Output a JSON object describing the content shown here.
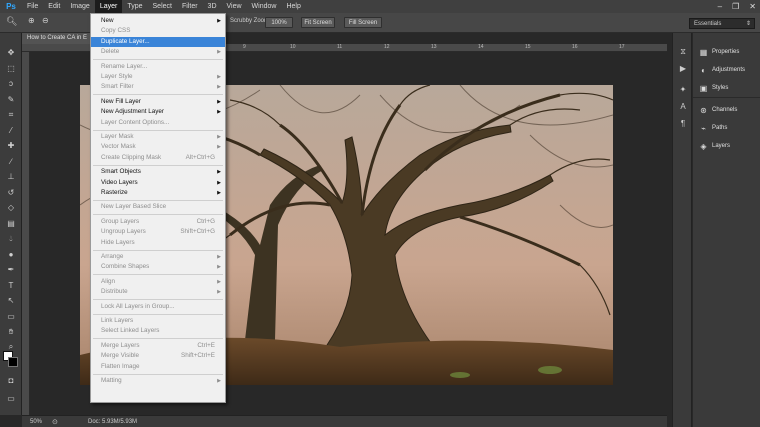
{
  "menubar": {
    "logo": "Ps",
    "items": [
      "File",
      "Edit",
      "Image",
      "Layer",
      "Type",
      "Select",
      "Filter",
      "3D",
      "View",
      "Window",
      "Help"
    ],
    "active_index": 3
  },
  "options_bar": {
    "scrubby_zoom": "Scrubby Zoom",
    "btn_100": "100%",
    "btn_fit": "Fit Screen",
    "btn_fill": "Fill Screen",
    "workspace": "Essentials"
  },
  "document": {
    "tab_title": "How to Create CA in E",
    "zoom": "50%",
    "doc_size": "Doc: 5.93M/5.93M"
  },
  "ruler": {
    "marks": [
      "6",
      "7",
      "8",
      "9",
      "10",
      "11",
      "12",
      "13",
      "14",
      "15",
      "16",
      "17"
    ]
  },
  "panels": {
    "items": [
      {
        "label": "Properties",
        "icon": "properties-icon",
        "glyph": "▦"
      },
      {
        "label": "Adjustments",
        "icon": "adjustments-icon",
        "glyph": "◐"
      },
      {
        "label": "Styles",
        "icon": "styles-icon",
        "glyph": "▣"
      },
      {
        "label": "Channels",
        "icon": "channels-icon",
        "glyph": "⊛"
      },
      {
        "label": "Paths",
        "icon": "paths-icon",
        "glyph": "⌁"
      },
      {
        "label": "Layers",
        "icon": "layers-icon",
        "glyph": "◈"
      }
    ]
  },
  "layer_menu": {
    "items": [
      {
        "label": "New",
        "arrow": true
      },
      {
        "label": "Copy CSS",
        "disabled": true
      },
      {
        "label": "Duplicate Layer...",
        "highlighted": true
      },
      {
        "label": "Delete",
        "disabled": true,
        "arrow": true,
        "sep_after": true
      },
      {
        "label": "Rename Layer...",
        "disabled": true
      },
      {
        "label": "Layer Style",
        "disabled": true,
        "arrow": true
      },
      {
        "label": "Smart Filter",
        "disabled": true,
        "arrow": true,
        "sep_after": true
      },
      {
        "label": "New Fill Layer",
        "arrow": true
      },
      {
        "label": "New Adjustment Layer",
        "arrow": true
      },
      {
        "label": "Layer Content Options...",
        "disabled": true,
        "sep_after": true
      },
      {
        "label": "Layer Mask",
        "disabled": true,
        "arrow": true
      },
      {
        "label": "Vector Mask",
        "disabled": true,
        "arrow": true
      },
      {
        "label": "Create Clipping Mask",
        "disabled": true,
        "shortcut": "Alt+Ctrl+G",
        "sep_after": true
      },
      {
        "label": "Smart Objects",
        "arrow": true
      },
      {
        "label": "Video Layers",
        "arrow": true
      },
      {
        "label": "Rasterize",
        "arrow": true,
        "sep_after": true
      },
      {
        "label": "New Layer Based Slice",
        "disabled": true,
        "sep_after": true
      },
      {
        "label": "Group Layers",
        "disabled": true,
        "shortcut": "Ctrl+G"
      },
      {
        "label": "Ungroup Layers",
        "disabled": true,
        "shortcut": "Shift+Ctrl+G"
      },
      {
        "label": "Hide Layers",
        "disabled": true,
        "sep_after": true
      },
      {
        "label": "Arrange",
        "disabled": true,
        "arrow": true
      },
      {
        "label": "Combine Shapes",
        "disabled": true,
        "arrow": true,
        "sep_after": true
      },
      {
        "label": "Align",
        "disabled": true,
        "arrow": true
      },
      {
        "label": "Distribute",
        "disabled": true,
        "arrow": true,
        "sep_after": true
      },
      {
        "label": "Lock All Layers in Group...",
        "disabled": true,
        "sep_after": true
      },
      {
        "label": "Link Layers",
        "disabled": true
      },
      {
        "label": "Select Linked Layers",
        "disabled": true,
        "sep_after": true
      },
      {
        "label": "Merge Layers",
        "disabled": true,
        "shortcut": "Ctrl+E"
      },
      {
        "label": "Merge Visible",
        "disabled": true,
        "shortcut": "Shift+Ctrl+E"
      },
      {
        "label": "Flatten Image",
        "disabled": true,
        "sep_after": true
      },
      {
        "label": "Matting",
        "disabled": true,
        "arrow": true
      }
    ]
  },
  "tools": [
    "move-tool",
    "marquee-tool",
    "lasso-tool",
    "quick-select-tool",
    "crop-tool",
    "eyedropper-tool",
    "healing-tool",
    "brush-tool",
    "clone-stamp-tool",
    "history-brush-tool",
    "eraser-tool",
    "gradient-tool",
    "blur-tool",
    "dodge-tool",
    "pen-tool",
    "type-tool",
    "path-select-tool",
    "shape-tool",
    "hand-tool",
    "zoom-tool"
  ],
  "colors": {
    "menu_highlight": "#3a84d8",
    "app_bg": "#282828",
    "logo": "#31a8ff"
  }
}
